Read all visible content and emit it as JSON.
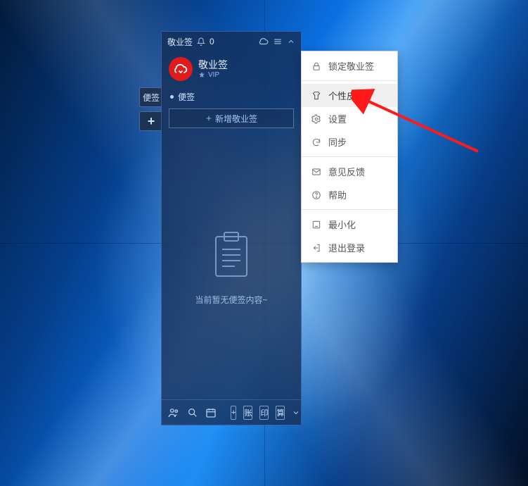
{
  "titlebar": {
    "app_name": "敬业签",
    "notification_count": "0"
  },
  "profile": {
    "brand_name": "敬业签",
    "vip_label": "VIP"
  },
  "section": {
    "title": "便签"
  },
  "add_button": {
    "label": "新增敬业签"
  },
  "side_tabs": {
    "note_label": "便签",
    "plus_label": "+"
  },
  "empty_state": {
    "text": "当前暂无便签内容~"
  },
  "bottom": {
    "sq1": "+",
    "sq2": "账",
    "sq3": "印",
    "sq4": "算"
  },
  "menu": {
    "lock": "锁定敬业签",
    "skin": "个性皮肤",
    "settings": "设置",
    "sync": "同步",
    "feedback": "意见反馈",
    "help": "帮助",
    "minimize": "最小化",
    "logout": "退出登录"
  }
}
